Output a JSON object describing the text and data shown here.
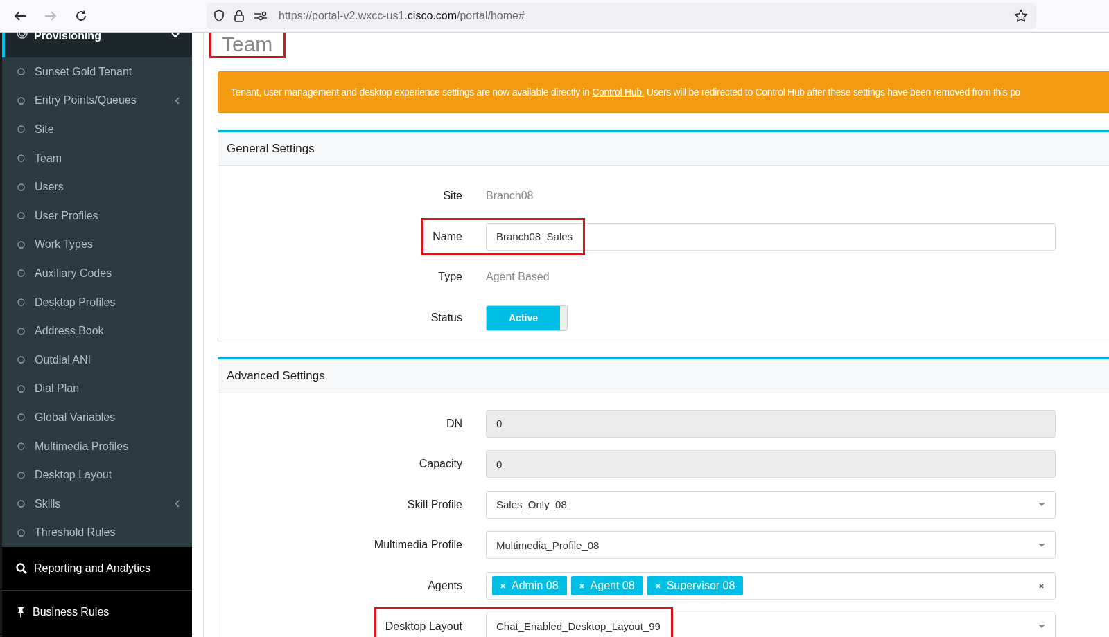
{
  "browser": {
    "forward_enabled": false,
    "url_prefix": "https://portal-v2.wxcc-us1.",
    "url_domain": "cisco.com",
    "url_suffix": "/portal/home#"
  },
  "sidebar": {
    "section": {
      "label": "Provisioning",
      "expanded": true,
      "items": [
        {
          "label": "Sunset Gold Tenant",
          "expandable": false
        },
        {
          "label": "Entry Points/Queues",
          "expandable": true
        },
        {
          "label": "Site",
          "expandable": false
        },
        {
          "label": "Team",
          "expandable": false
        },
        {
          "label": "Users",
          "expandable": false
        },
        {
          "label": "User Profiles",
          "expandable": false
        },
        {
          "label": "Work Types",
          "expandable": false
        },
        {
          "label": "Auxiliary Codes",
          "expandable": false
        },
        {
          "label": "Desktop Profiles",
          "expandable": false
        },
        {
          "label": "Address Book",
          "expandable": false
        },
        {
          "label": "Outdial ANI",
          "expandable": false
        },
        {
          "label": "Dial Plan",
          "expandable": false
        },
        {
          "label": "Global Variables",
          "expandable": false
        },
        {
          "label": "Multimedia Profiles",
          "expandable": false
        },
        {
          "label": "Desktop Layout",
          "expandable": false
        },
        {
          "label": "Skills",
          "expandable": true
        },
        {
          "label": "Threshold Rules",
          "expandable": false
        }
      ]
    },
    "links": [
      {
        "label": "Reporting and Analytics",
        "kind": "search"
      },
      {
        "label": "Business Rules",
        "kind": "pin"
      }
    ]
  },
  "page": {
    "title": "Team",
    "highlighted": true
  },
  "banner": {
    "text_before": "Tenant, user management and desktop experience settings are now available directly in",
    "link": "Control Hub.",
    "text_after": "Users will be redirected to Control Hub after these settings have been removed from this po"
  },
  "general_settings": {
    "title": "General Settings",
    "fields": [
      {
        "kind": "static",
        "label": "Site",
        "value": "Branch08",
        "highlighted": false
      },
      {
        "kind": "input",
        "label": "Name",
        "value": "Branch08_Sales",
        "highlighted": true
      },
      {
        "kind": "static",
        "label": "Type",
        "value": "Agent Based",
        "highlighted": false
      },
      {
        "kind": "toggle",
        "label": "Status",
        "value": "Active",
        "on": true,
        "highlighted": false
      }
    ]
  },
  "advanced_settings": {
    "title": "Advanced Settings",
    "fields": [
      {
        "kind": "readonly",
        "label": "DN",
        "value": "0",
        "highlighted": false
      },
      {
        "kind": "readonly",
        "label": "Capacity",
        "value": "0",
        "highlighted": false
      },
      {
        "kind": "select",
        "label": "Skill Profile",
        "value": "Sales_Only_08",
        "highlighted": false
      },
      {
        "kind": "select",
        "label": "Multimedia Profile",
        "value": "Multimedia_Profile_08",
        "highlighted": false
      },
      {
        "kind": "tags",
        "label": "Agents",
        "tags": [
          "Admin 08",
          "Agent 08",
          "Supervisor 08"
        ],
        "highlighted": false
      },
      {
        "kind": "select",
        "label": "Desktop Layout",
        "value": "Chat_Enabled_Desktop_Layout_99",
        "highlighted": true
      }
    ]
  }
}
